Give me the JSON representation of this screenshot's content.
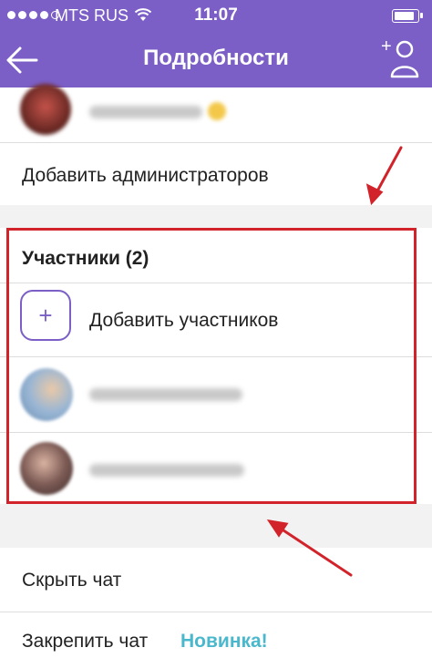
{
  "status_bar": {
    "carrier": "MTS RUS",
    "time": "11:07",
    "signal_bars": 4
  },
  "nav": {
    "title": "Подробности",
    "back_icon": "arrow-left-icon",
    "add_user_icon": "add-person-icon",
    "add_user_plus": "+"
  },
  "admin_member": {
    "avatar_color": "#a8443a"
  },
  "actions": {
    "add_admins": "Добавить администраторов"
  },
  "participants": {
    "title": "Участники (2)",
    "add_label": "Добавить участников",
    "add_icon": "+",
    "members": [
      {
        "avatar_color": "#7fa1c4"
      },
      {
        "avatar_color": "#6b4f4a"
      }
    ]
  },
  "footer": {
    "hide_chat": "Скрыть чат",
    "pin_chat": "Закрепить чат",
    "new_badge": "Новинка!"
  },
  "colors": {
    "header": "#7b5fc6",
    "annotation": "#d2232a",
    "accent": "#4ab8cc"
  }
}
